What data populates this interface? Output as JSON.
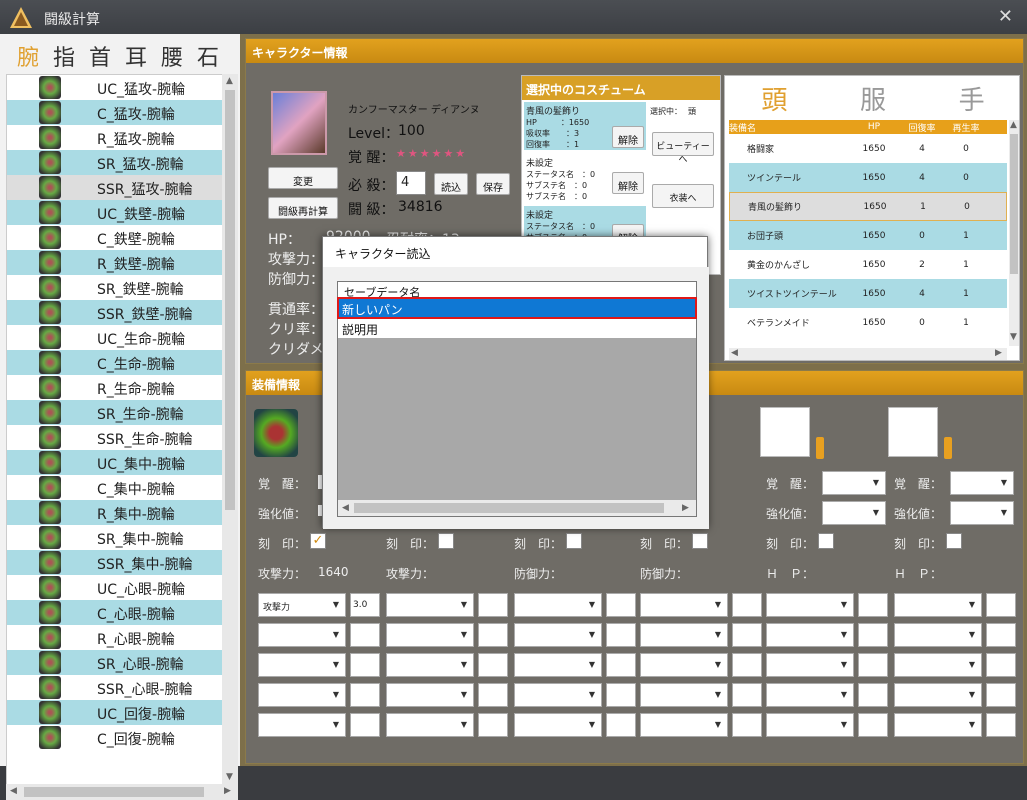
{
  "app": {
    "title": "闘級計算",
    "close": "✕"
  },
  "left": {
    "tabs": [
      "腕",
      "指",
      "首",
      "耳",
      "腰",
      "石"
    ],
    "items": [
      "UC_猛攻-腕輪",
      "C_猛攻-腕輪",
      "R_猛攻-腕輪",
      "SR_猛攻-腕輪",
      "SSR_猛攻-腕輪",
      "UC_鉄壁-腕輪",
      "C_鉄壁-腕輪",
      "R_鉄壁-腕輪",
      "SR_鉄壁-腕輪",
      "SSR_鉄壁-腕輪",
      "UC_生命-腕輪",
      "C_生命-腕輪",
      "R_生命-腕輪",
      "SR_生命-腕輪",
      "SSR_生命-腕輪",
      "UC_集中-腕輪",
      "C_集中-腕輪",
      "R_集中-腕輪",
      "SR_集中-腕輪",
      "SSR_集中-腕輪",
      "UC_心眼-腕輪",
      "C_心眼-腕輪",
      "R_心眼-腕輪",
      "SR_心眼-腕輪",
      "SSR_心眼-腕輪",
      "UC_回復-腕輪",
      "C_回復-腕輪"
    ]
  },
  "character": {
    "header": "キャラクター情報",
    "name": "カンフーマスター ディアンヌ",
    "level_label": "Level：",
    "level": "100",
    "awaken_label": "覚 醒：",
    "awaken_stars": "★★★★★★",
    "ult_label": "必 殺：",
    "ult_value": "4",
    "grade_label": "闘 級：",
    "grade": "34816",
    "btn_change": "変更",
    "btn_recalc": "闘級再計算",
    "btn_load": "読込",
    "btn_save": "保存",
    "hp_label": "HP：",
    "hp_value": "92000",
    "endure_label": "忍耐率：13",
    "atk_label": "攻撃力：",
    "def_label": "防御力：",
    "pierce_label": "貫通率：",
    "crit_label": "クリ率：",
    "critdmg_label": "クリダメ："
  },
  "costume": {
    "header": "選択中のコスチューム",
    "selected_label": "選択中：",
    "selected_value": "頭",
    "block1_title": "青風の髪飾り",
    "block1_lines": [
      "HP　　　：1650",
      "吸収率　　：3",
      "回復率　　：1"
    ],
    "unset": "未設定",
    "unset_lines": [
      "ステータス名　：0",
      "サブステ名　：0",
      "サブステ名　：0"
    ],
    "btn_release": "解除",
    "btn_beauty": "ビューティーへ",
    "btn_outfit": "衣装へ"
  },
  "gear": {
    "tabs": [
      "頭",
      "服",
      "手"
    ],
    "columns": [
      "装備名",
      "HP",
      "回復率",
      "再生率"
    ],
    "rows": [
      [
        "格闘家",
        "1650",
        "4",
        "0"
      ],
      [
        "ツインテール",
        "1650",
        "4",
        "0"
      ],
      [
        "青風の髪飾り",
        "1650",
        "1",
        "0"
      ],
      [
        "お団子頭",
        "1650",
        "0",
        "1"
      ],
      [
        "黄金のかんざし",
        "1650",
        "2",
        "1"
      ],
      [
        "ツイストツインテール",
        "1650",
        "4",
        "1"
      ],
      [
        "ベテランメイド",
        "1650",
        "0",
        "1"
      ]
    ]
  },
  "equip": {
    "header": "装備情報",
    "awaken_label": "覚　醒：",
    "enhance_label": "強化値：",
    "stamp_label": "刻　印：",
    "atk_label": "攻撃力：",
    "atk_value": "1640",
    "def_label": "防御力：",
    "hp_label": "Ｈ　Ｐ：",
    "sub_select": "攻撃力",
    "sub_value": "3.0",
    "awaken_prefix": "★",
    "enhance_prefix": "+5"
  },
  "dialog": {
    "title": "キャラクター読込",
    "col_header": "セーブデータ名",
    "rows": [
      "新しいパン",
      "説明用"
    ],
    "selected_index": 0
  },
  "colors": {
    "accent": "#e0a030",
    "row_alt": "#aadbe4",
    "selection": "#0f78d4",
    "highlight_border": "#e01818"
  }
}
